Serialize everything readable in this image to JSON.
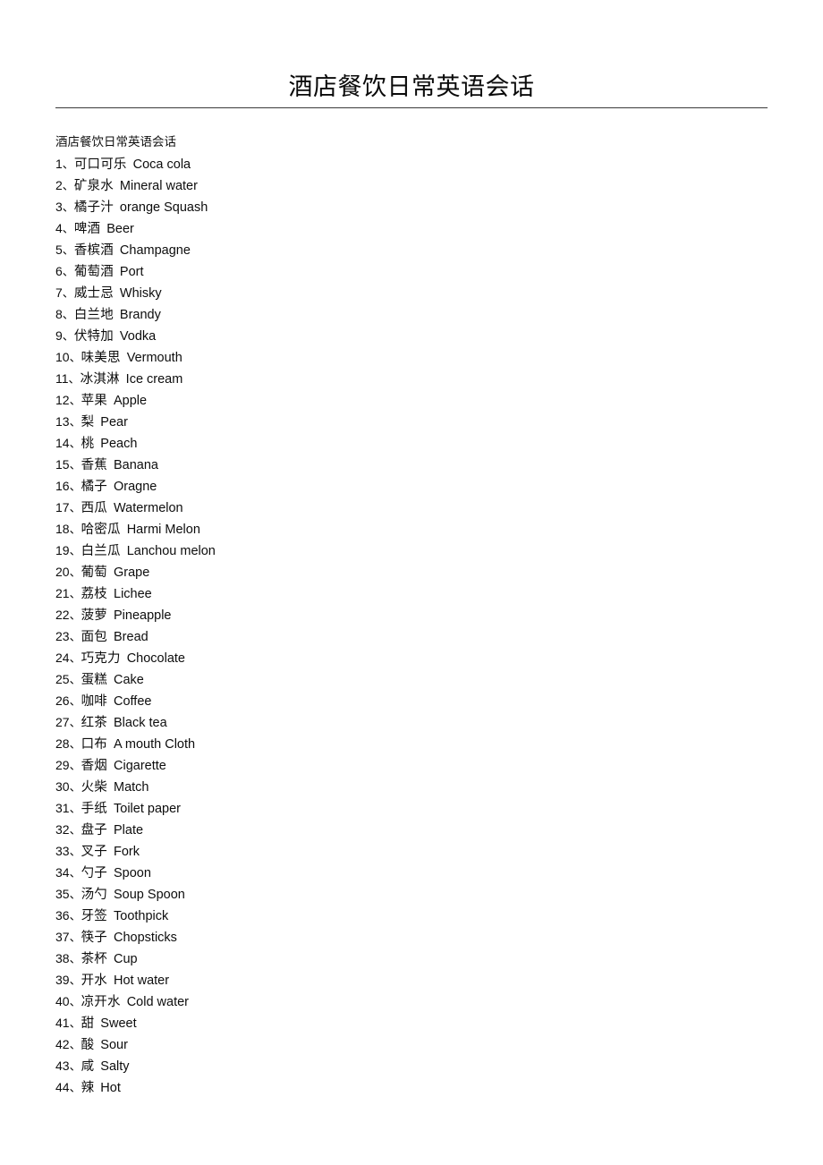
{
  "document": {
    "title": "酒店餐饮日常英语会话",
    "intro_line": "酒店餐饮日常英语会话",
    "separator": "、",
    "colors": {
      "page_background": "#ffffff",
      "text": "#0d0d0d",
      "rule": "#3a3a3a"
    }
  },
  "vocabulary": [
    {
      "index": "1",
      "zh": "可口可乐",
      "en": "Coca cola"
    },
    {
      "index": "2",
      "zh": "矿泉水",
      "en": "Mineral water"
    },
    {
      "index": "3",
      "zh": "橘子汁",
      "en": "orange Squash"
    },
    {
      "index": "4",
      "zh": "啤酒",
      "en": "Beer"
    },
    {
      "index": "5",
      "zh": "香槟酒",
      "en": "Champagne"
    },
    {
      "index": "6",
      "zh": "葡萄酒",
      "en": "Port"
    },
    {
      "index": "7",
      "zh": "威士忌",
      "en": "Whisky"
    },
    {
      "index": "8",
      "zh": "白兰地",
      "en": "Brandy"
    },
    {
      "index": "9",
      "zh": "伏特加",
      "en": "Vodka"
    },
    {
      "index": "10",
      "zh": "味美思",
      "en": "Vermouth"
    },
    {
      "index": "11",
      "zh": "冰淇淋",
      "en": "Ice cream"
    },
    {
      "index": "12",
      "zh": "苹果",
      "en": "Apple"
    },
    {
      "index": "13",
      "zh": "梨",
      "en": "Pear"
    },
    {
      "index": "14",
      "zh": "桃",
      "en": "Peach"
    },
    {
      "index": "15",
      "zh": "香蕉",
      "en": "Banana"
    },
    {
      "index": "16",
      "zh": "橘子",
      "en": "Oragne"
    },
    {
      "index": "17",
      "zh": "西瓜",
      "en": "Watermelon"
    },
    {
      "index": "18",
      "zh": "哈密瓜",
      "en": "Harmi Melon"
    },
    {
      "index": "19",
      "zh": "白兰瓜",
      "en": "Lanchou melon"
    },
    {
      "index": "20",
      "zh": "葡萄",
      "en": "Grape"
    },
    {
      "index": "21",
      "zh": "荔枝",
      "en": "Lichee"
    },
    {
      "index": "22",
      "zh": "菠萝",
      "en": "Pineapple"
    },
    {
      "index": "23",
      "zh": "面包",
      "en": "Bread"
    },
    {
      "index": "24",
      "zh": "巧克力",
      "en": "Chocolate"
    },
    {
      "index": "25",
      "zh": "蛋糕",
      "en": "Cake"
    },
    {
      "index": "26",
      "zh": "咖啡",
      "en": "Coffee"
    },
    {
      "index": "27",
      "zh": "红茶",
      "en": "Black tea"
    },
    {
      "index": "28",
      "zh": "口布",
      "en": "A mouth Cloth"
    },
    {
      "index": "29",
      "zh": "香烟",
      "en": "Cigarette"
    },
    {
      "index": "30",
      "zh": "火柴",
      "en": "Match"
    },
    {
      "index": "31",
      "zh": "手纸",
      "en": "Toilet paper"
    },
    {
      "index": "32",
      "zh": "盘子",
      "en": "Plate"
    },
    {
      "index": "33",
      "zh": "叉子",
      "en": "Fork"
    },
    {
      "index": "34",
      "zh": "勺子",
      "en": "Spoon"
    },
    {
      "index": "35",
      "zh": "汤勺",
      "en": "Soup Spoon"
    },
    {
      "index": "36",
      "zh": "牙签",
      "en": "Toothpick"
    },
    {
      "index": "37",
      "zh": "筷子",
      "en": "Chopsticks"
    },
    {
      "index": "38",
      "zh": "茶杯",
      "en": "Cup"
    },
    {
      "index": "39",
      "zh": "开水",
      "en": "Hot water"
    },
    {
      "index": "40",
      "zh": "凉开水",
      "en": "Cold water"
    },
    {
      "index": "41",
      "zh": "甜",
      "en": "Sweet"
    },
    {
      "index": "42",
      "zh": "酸",
      "en": "Sour"
    },
    {
      "index": "43",
      "zh": "咸",
      "en": "Salty"
    },
    {
      "index": "44",
      "zh": "辣",
      "en": "Hot"
    }
  ]
}
